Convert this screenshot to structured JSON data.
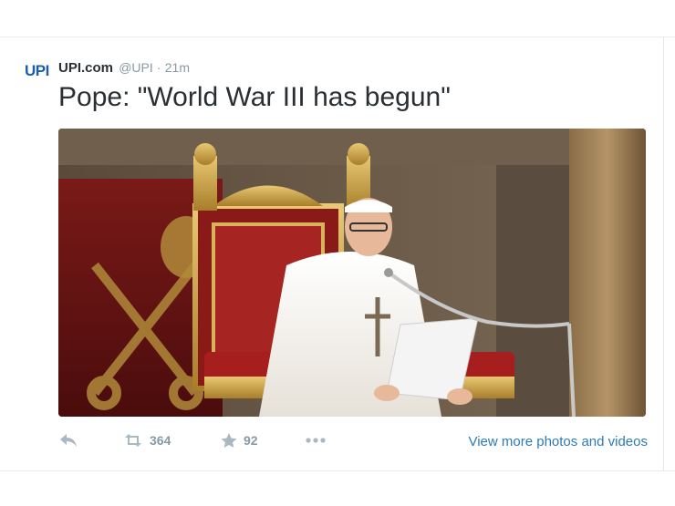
{
  "tweet": {
    "avatar_text": "UPI",
    "fullname": "UPI.com",
    "handle": "@UPI",
    "separator": "·",
    "time": "21m",
    "text": "Pope: \"World War III has begun\""
  },
  "actions": {
    "reply_icon": "reply-icon",
    "retweet_icon": "retweet-icon",
    "retweet_count": "364",
    "favorite_icon": "star-icon",
    "favorite_count": "92",
    "more_icon": "more-icon",
    "view_more_label": "View more photos and videos"
  },
  "colors": {
    "link": "#2b7bb9",
    "muted": "#8899a6",
    "text": "#292f33",
    "avatar": "#1a5fa8"
  }
}
